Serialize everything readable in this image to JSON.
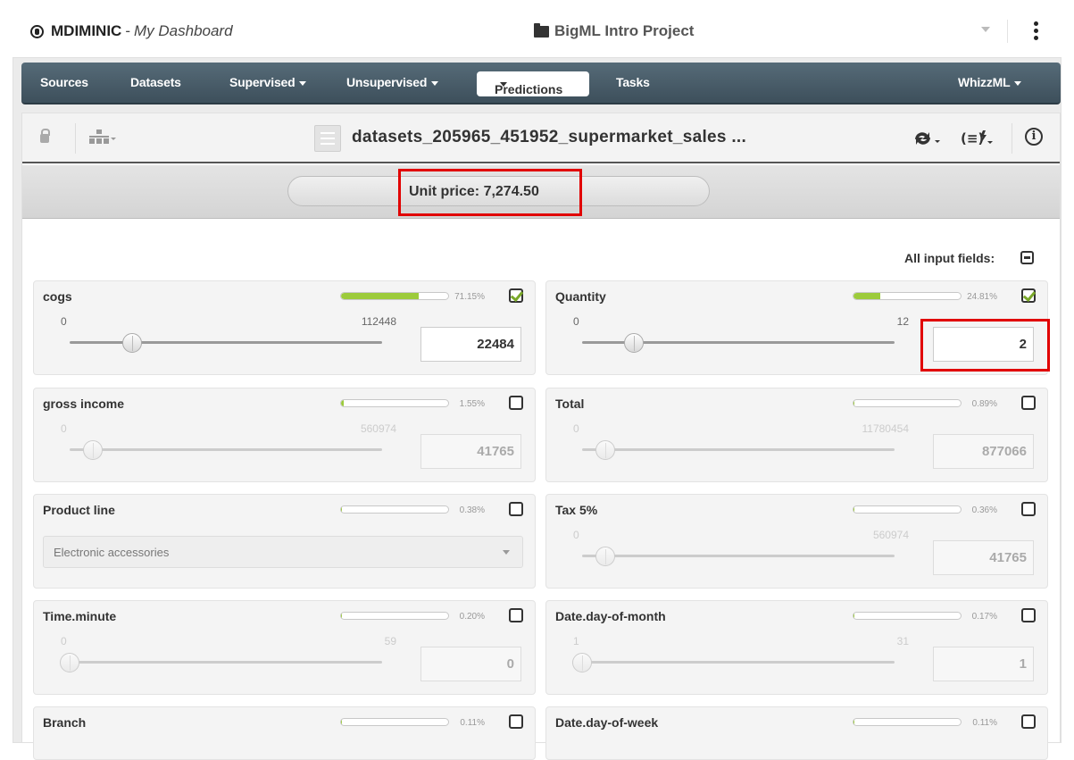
{
  "header": {
    "user": "MDIMINIC",
    "dashboard": "My Dashboard",
    "project": "BigML Intro Project"
  },
  "nav": {
    "items": [
      "Sources",
      "Datasets",
      "Supervised",
      "Unsupervised",
      "Predictions",
      "Tasks",
      "WhizzML"
    ],
    "active": "Predictions"
  },
  "dataset": {
    "title": "datasets_205965_451952_supermarket_sales ..."
  },
  "prediction": {
    "text": "Unit price: 7,274.50"
  },
  "all_fields_label": "All input fields:",
  "colors": {
    "navbar": "#4a5d69",
    "importance_fill": "#9ccb3b",
    "highlight": "#e10000"
  },
  "fields": [
    {
      "name": "cogs",
      "importance": "71.15%",
      "importance_value": 0.7115,
      "checked": true,
      "min": "0",
      "max": "112448",
      "value": "22484",
      "slider_pos": 0.2,
      "enabled": true
    },
    {
      "name": "Quantity",
      "importance": "24.81%",
      "importance_value": 0.2481,
      "checked": true,
      "min": "0",
      "max": "12",
      "value": "2",
      "slider_pos": 0.167,
      "enabled": true
    },
    {
      "name": "gross income",
      "importance": "1.55%",
      "importance_value": 0.0155,
      "checked": false,
      "min": "0",
      "max": "560974",
      "value": "41765",
      "slider_pos": 0.074,
      "enabled": false
    },
    {
      "name": "Total",
      "importance": "0.89%",
      "importance_value": 0.0089,
      "checked": false,
      "min": "0",
      "max": "11780454",
      "value": "877066",
      "slider_pos": 0.074,
      "enabled": false
    },
    {
      "name": "Product line",
      "importance": "0.38%",
      "importance_value": 0.0038,
      "checked": false,
      "select": "Electronic accessories",
      "enabled": false
    },
    {
      "name": "Tax 5%",
      "importance": "0.36%",
      "importance_value": 0.0036,
      "checked": false,
      "min": "0",
      "max": "560974",
      "value": "41765",
      "slider_pos": 0.074,
      "enabled": false
    },
    {
      "name": "Time.minute",
      "importance": "0.20%",
      "importance_value": 0.002,
      "checked": false,
      "min": "0",
      "max": "59",
      "value": "0",
      "slider_pos": 0,
      "enabled": false
    },
    {
      "name": "Date.day-of-month",
      "importance": "0.17%",
      "importance_value": 0.0017,
      "checked": false,
      "min": "1",
      "max": "31",
      "value": "1",
      "slider_pos": 0,
      "enabled": false
    },
    {
      "name": "Branch",
      "importance": "0.11%",
      "importance_value": 0.0011,
      "checked": false,
      "enabled": false
    },
    {
      "name": "Date.day-of-week",
      "importance": "0.11%",
      "importance_value": 0.0011,
      "checked": false,
      "enabled": false
    }
  ]
}
